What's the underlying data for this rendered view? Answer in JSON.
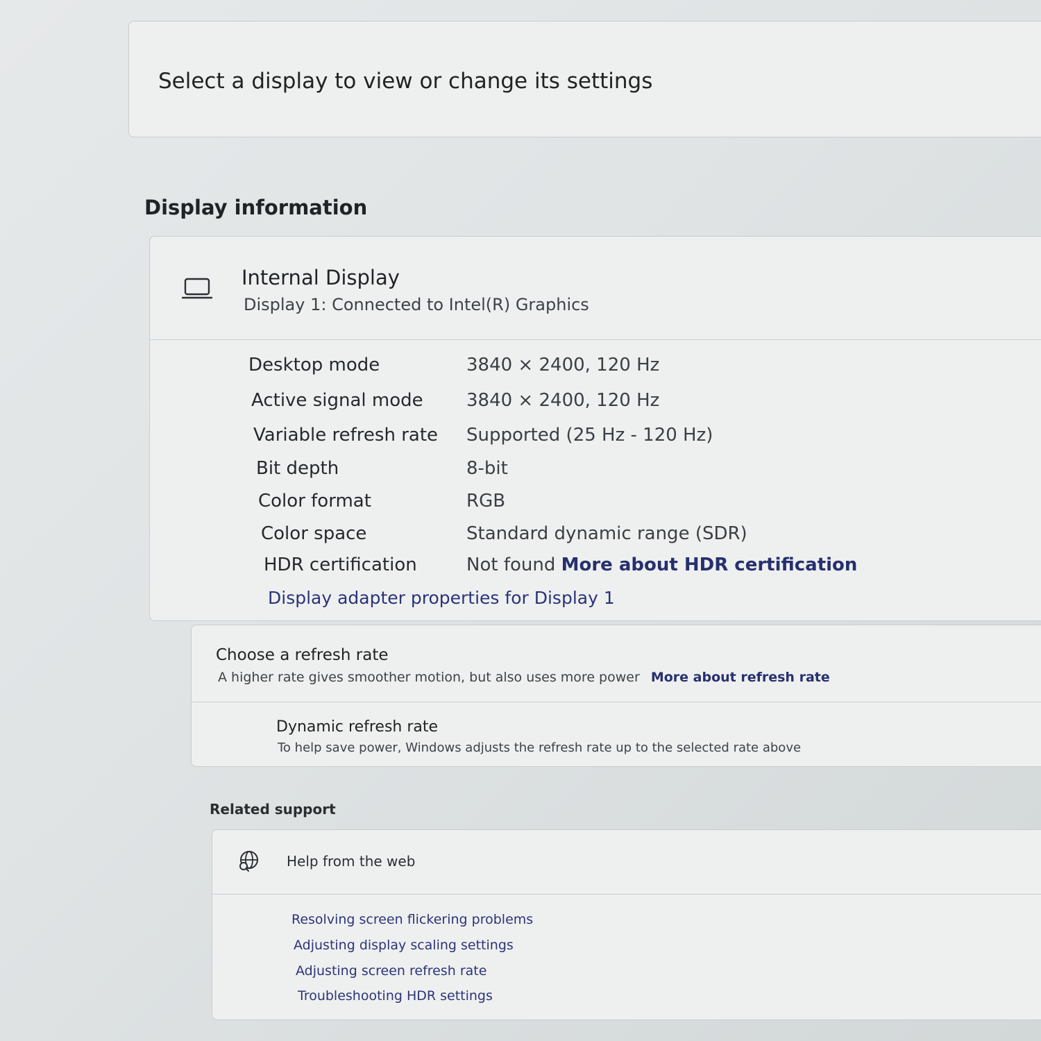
{
  "select_display": {
    "title": "Select a display to view or change its settings"
  },
  "display_information": {
    "heading": "Display information",
    "display": {
      "icon": "laptop-icon",
      "name": "Internal Display",
      "subtitle": "Display 1: Connected to Intel(R) Graphics"
    },
    "rows": [
      {
        "label": "Desktop mode",
        "value": "3840 × 2400, 120 Hz"
      },
      {
        "label": "Active signal mode",
        "value": "3840 × 2400, 120 Hz"
      },
      {
        "label": "Variable refresh rate",
        "value": "Supported (25 Hz - 120 Hz)"
      },
      {
        "label": "Bit depth",
        "value": "8-bit"
      },
      {
        "label": "Color format",
        "value": "RGB"
      },
      {
        "label": "Color space",
        "value": "Standard dynamic range (SDR)"
      },
      {
        "label": "HDR certification",
        "value": "Not found",
        "link": "More about HDR certification"
      }
    ],
    "adapter_link": "Display adapter properties for Display 1"
  },
  "refresh_rate": {
    "title": "Choose a refresh rate",
    "description": "A higher rate gives smoother motion, but also uses more power",
    "link": "More about refresh rate",
    "dynamic": {
      "title": "Dynamic refresh rate",
      "description": "To help save power, Windows adjusts the refresh rate up to the selected rate above"
    }
  },
  "related_support": {
    "heading": "Related support",
    "help": {
      "icon": "globe-icon",
      "title": "Help from the web"
    },
    "links": [
      "Resolving screen flickering problems",
      "Adjusting display scaling settings",
      "Adjusting screen refresh rate",
      "Troubleshooting HDR settings"
    ]
  },
  "colors": {
    "link": "#27306e",
    "card_background": "#eef0f0",
    "page_background": "#dfe3e4"
  }
}
